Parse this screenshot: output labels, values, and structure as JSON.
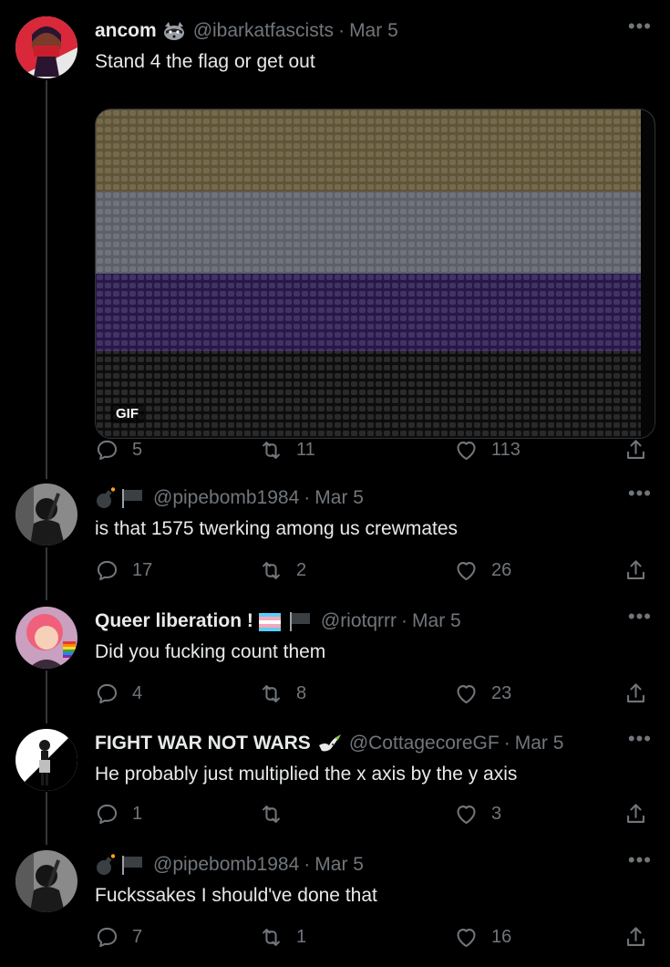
{
  "tweets": [
    {
      "name": "ancom",
      "name_emoji": "raccoon-icon",
      "handle": "@ibarkatfascists",
      "date": "Mar 5",
      "text": "Stand 4 the flag or get out",
      "media": {
        "badge": "GIF",
        "stripes": [
          "#d8bc7a",
          "#d4d6ea",
          "#5a3aa8",
          "#1a1a1a"
        ]
      },
      "replies": "5",
      "retweets": "11",
      "likes": "113"
    },
    {
      "name": "",
      "name_emoji": "bomb-flag-icon",
      "handle": "@pipebomb1984",
      "date": "Mar 5",
      "text": "is that 1575 twerking among us crewmates",
      "replies": "17",
      "retweets": "2",
      "likes": "26"
    },
    {
      "name": "Queer liberation !",
      "name_emoji": "trans-flag-black-flag-icon",
      "handle": "@riotqrrr",
      "date": "Mar 5",
      "text": "Did you fucking count them",
      "replies": "4",
      "retweets": "8",
      "likes": "23"
    },
    {
      "name": "FIGHT WAR NOT WARS",
      "name_emoji": "dove-icon",
      "handle": "@CottagecoreGF",
      "date": "Mar 5",
      "text": "He probably just multiplied the x axis by the y axis",
      "replies": "1",
      "retweets": "",
      "likes": "3"
    },
    {
      "name": "",
      "name_emoji": "bomb-flag-icon",
      "handle": "@pipebomb1984",
      "date": "Mar 5",
      "text": "Fuckssakes I should've done that",
      "replies": "7",
      "retweets": "1",
      "likes": "16"
    }
  ],
  "more_label": "•••"
}
